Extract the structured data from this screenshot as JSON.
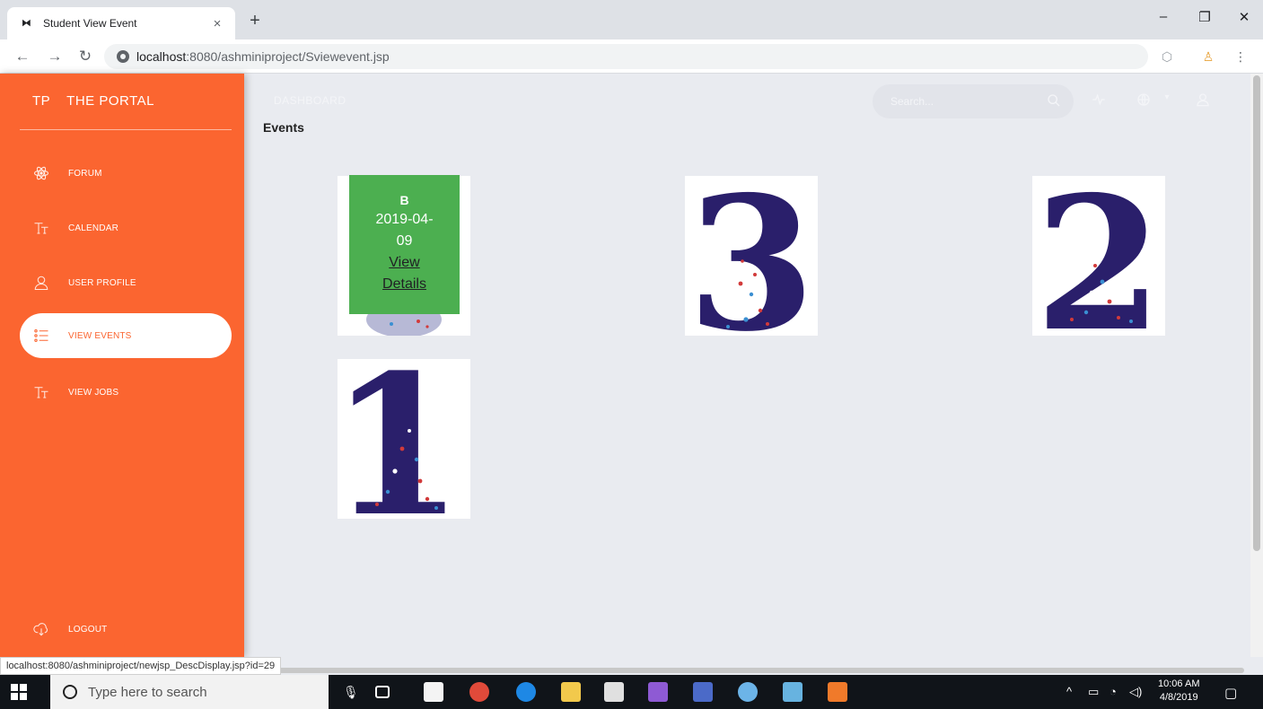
{
  "browser": {
    "tab_title": "Student View Event",
    "tab_close": "×",
    "new_tab": "+",
    "url_host": "localhost",
    "url_path": ":8080/ashminiproject/Sviewevent.jsp",
    "minimize": "–",
    "restore": "❐",
    "close": "✕"
  },
  "sidebar": {
    "brand_abbr": "TP",
    "brand_name": "THE PORTAL",
    "items": [
      {
        "label": "FORUM",
        "icon": "atom-icon"
      },
      {
        "label": "CALENDAR",
        "icon": "text-size-icon"
      },
      {
        "label": "USER PROFILE",
        "icon": "user-icon"
      },
      {
        "label": "VIEW EVENTS",
        "icon": "list-icon",
        "active": true
      },
      {
        "label": "VIEW JOBS",
        "icon": "text-size-icon"
      }
    ],
    "logout_label": "LOGOUT"
  },
  "header": {
    "dashboard": "DASHBOARD",
    "search_placeholder": "Search..."
  },
  "main": {
    "section_title": "Events",
    "events": [
      {
        "digit": "",
        "name": "B",
        "date": "2019-04-09",
        "link": "View Details"
      },
      {
        "digit": "3"
      },
      {
        "digit": "2"
      },
      {
        "digit": "1"
      }
    ]
  },
  "status_bar_url": "localhost:8080/ashminiproject/newjsp_DescDisplay.jsp?id=29",
  "taskbar": {
    "search_placeholder": "Type here to search",
    "time": "10:06 AM",
    "date": "4/8/2019"
  },
  "colors": {
    "sidebar": "#fb6530",
    "overlay": "#4caf50",
    "digit": "#2a1f6b"
  }
}
